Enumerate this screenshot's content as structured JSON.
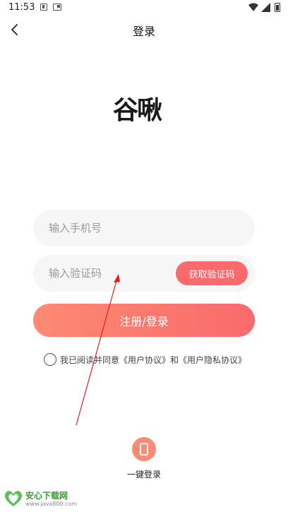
{
  "status_bar": {
    "time": "11:53"
  },
  "nav": {
    "title": "登录"
  },
  "logo": {
    "text": "谷啾"
  },
  "form": {
    "phone_placeholder": "输入手机号",
    "code_placeholder": "输入验证码",
    "get_code_label": "获取验证码",
    "submit_label": "注册/登录"
  },
  "agreement": {
    "text": "我已阅读并同意《用户协议》和《用户隐私协议》"
  },
  "quick_login": {
    "label": "一键登录"
  },
  "watermark": {
    "main": "安心下载网",
    "sub": "www.java800.com"
  },
  "colors": {
    "accent": "#f96a6c",
    "accent_start": "#fd8a72",
    "annotation": "#e0201c"
  }
}
